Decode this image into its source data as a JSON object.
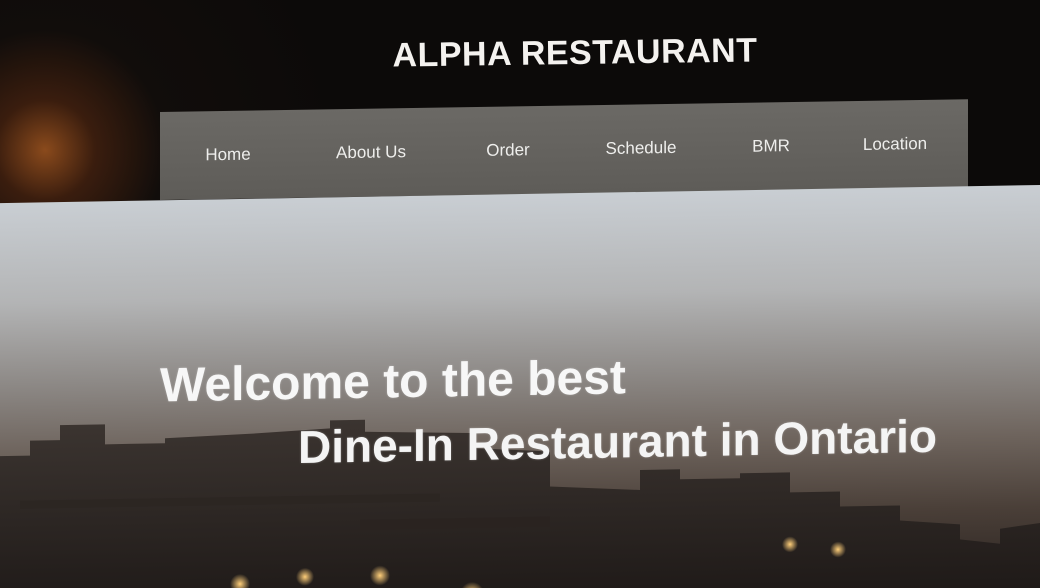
{
  "header": {
    "title": "ALPHA RESTAURANT"
  },
  "nav": {
    "items": [
      {
        "label": "Home"
      },
      {
        "label": "About Us"
      },
      {
        "label": "Order"
      },
      {
        "label": "Schedule"
      },
      {
        "label": "BMR"
      },
      {
        "label": "Location"
      }
    ]
  },
  "hero": {
    "line1": "Welcome to the best",
    "line2": "Dine-In Restaurant in Ontario"
  },
  "colors": {
    "page_background": "#0d0b0a",
    "navbar_background": "#65635f",
    "text_light": "#f4f2ef"
  }
}
